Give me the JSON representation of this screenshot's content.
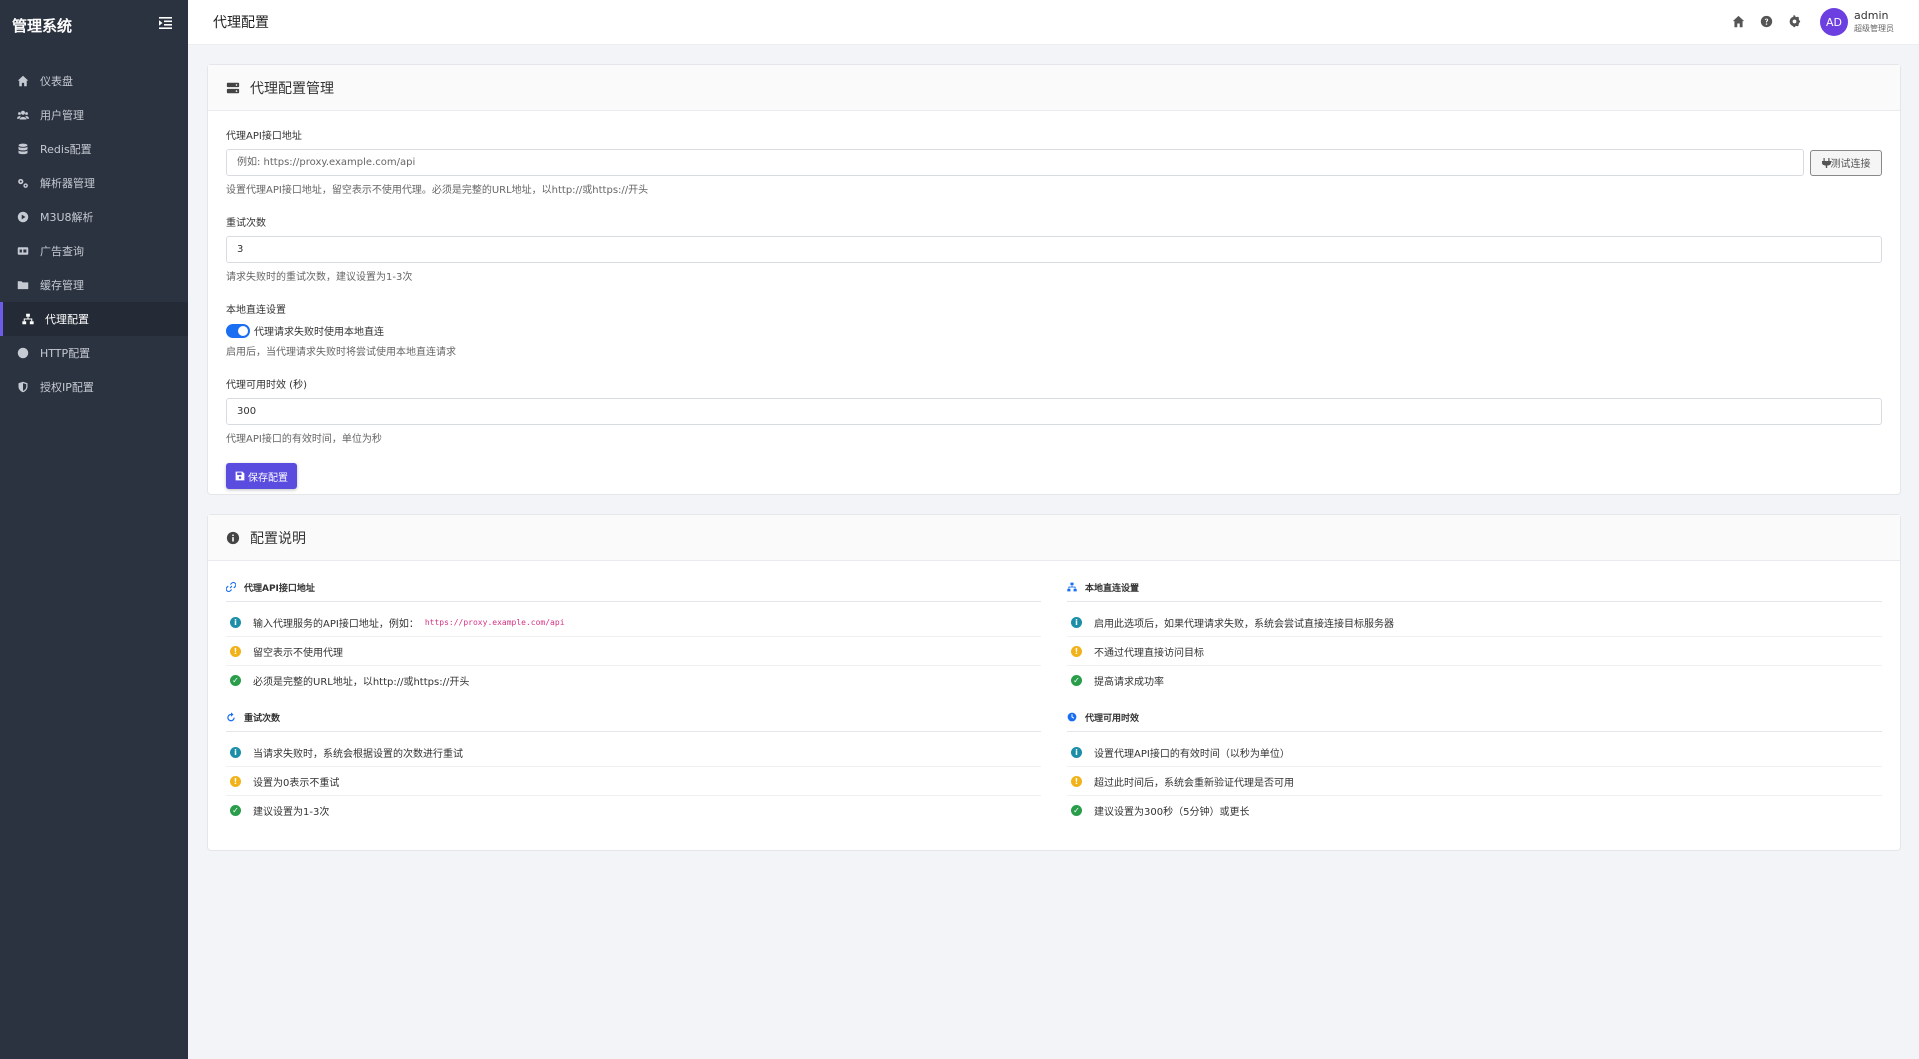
{
  "sidebar": {
    "brand": "管理系统",
    "items": [
      {
        "label": "仪表盘",
        "icon": "home-icon"
      },
      {
        "label": "用户管理",
        "icon": "users-icon"
      },
      {
        "label": "Redis配置",
        "icon": "database-icon"
      },
      {
        "label": "解析器管理",
        "icon": "gears-icon"
      },
      {
        "label": "M3U8解析",
        "icon": "play-icon"
      },
      {
        "label": "广告查询",
        "icon": "ad-icon"
      },
      {
        "label": "缓存管理",
        "icon": "folder-icon"
      },
      {
        "label": "代理配置",
        "icon": "sitemap-icon",
        "active": true
      },
      {
        "label": "HTTP配置",
        "icon": "globe-icon"
      },
      {
        "label": "授权IP配置",
        "icon": "shield-icon"
      }
    ]
  },
  "topbar": {
    "title": "代理配置",
    "user_initials": "AD",
    "user_name": "admin",
    "user_role": "超级管理员"
  },
  "form": {
    "title": "代理配置管理",
    "api_label": "代理API接口地址",
    "api_placeholder": "例如: https://proxy.example.com/api",
    "api_value": "",
    "test_button": "测试连接",
    "api_help": "设置代理API接口地址，留空表示不使用代理。必须是完整的URL地址，以http://或https://开头",
    "retry_label": "重试次数",
    "retry_value": "3",
    "retry_help": "请求失败时的重试次数，建议设置为1-3次",
    "direct_label": "本地直连设置",
    "direct_switch_label": "代理请求失败时使用本地直连",
    "direct_enabled": true,
    "direct_help": "启用后，当代理请求失败时将尝试使用本地直连请求",
    "ttl_label": "代理可用时效 (秒)",
    "ttl_value": "300",
    "ttl_help": "代理API接口的有效时间，单位为秒",
    "save_button": "保存配置"
  },
  "explain": {
    "title": "配置说明",
    "api": {
      "title": "代理API接口地址",
      "items": [
        {
          "text": "输入代理服务的API接口地址，例如：",
          "code": "https://proxy.example.com/api"
        },
        {
          "text": "留空表示不使用代理"
        },
        {
          "text": "必须是完整的URL地址，以http://或https://开头"
        }
      ]
    },
    "retry": {
      "title": "重试次数",
      "items": [
        {
          "text": "当请求失败时，系统会根据设置的次数进行重试"
        },
        {
          "text": "设置为0表示不重试"
        },
        {
          "text": "建议设置为1-3次"
        }
      ]
    },
    "direct": {
      "title": "本地直连设置",
      "items": [
        {
          "text": "启用此选项后，如果代理请求失败，系统会尝试直接连接目标服务器"
        },
        {
          "text": "不通过代理直接访问目标"
        },
        {
          "text": "提高请求成功率"
        }
      ]
    },
    "ttl": {
      "title": "代理可用时效",
      "items": [
        {
          "text": "设置代理API接口的有效时间（以秒为单位）"
        },
        {
          "text": "超过此时间后，系统会重新验证代理是否可用"
        },
        {
          "text": "建议设置为300秒（5分钟）或更长"
        }
      ]
    }
  },
  "colors": {
    "sidebar_bg": "#2c3340",
    "accent": "#5b4ce0",
    "switch_on": "#1a6ef2",
    "info": "#1b8fa8",
    "warn": "#f2b21a",
    "ok": "#2a9d4b"
  }
}
